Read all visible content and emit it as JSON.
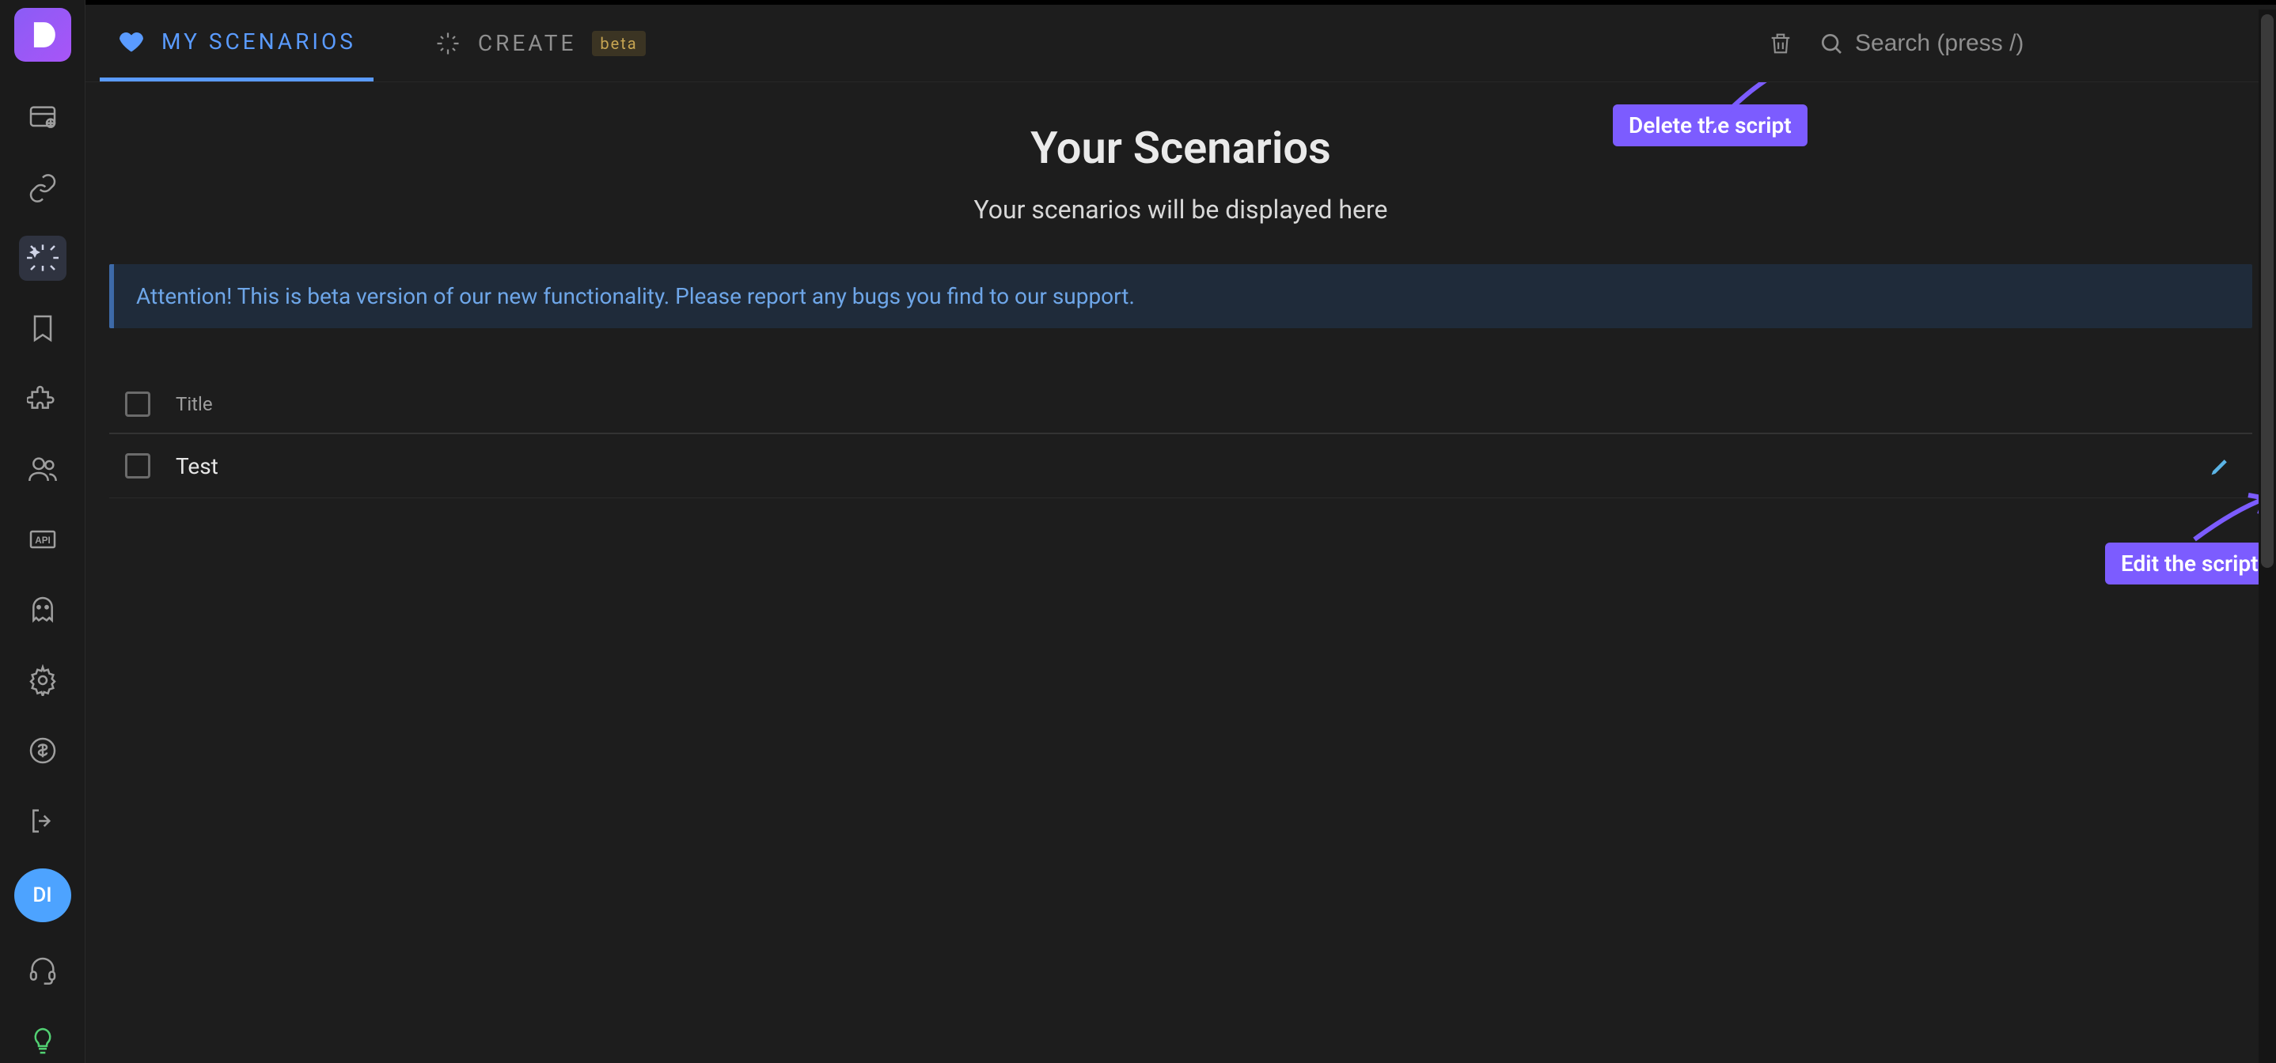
{
  "sidebar": {
    "avatar_initials": "DI"
  },
  "tabs": {
    "my_scenarios": "MY SCENARIOS",
    "create": "CREATE",
    "beta_label": "beta"
  },
  "search": {
    "placeholder": "Search (press /)"
  },
  "page": {
    "title": "Your Scenarios",
    "subtitle": "Your scenarios will be displayed here"
  },
  "alert": {
    "text": "Attention! This is beta version of our new functionality. Please report any bugs you find to our support."
  },
  "table": {
    "header_title": "Title",
    "rows": [
      {
        "title": "Test"
      }
    ]
  },
  "annotations": {
    "delete_tooltip": "Delete the script",
    "edit_tooltip": "Edit the script"
  }
}
